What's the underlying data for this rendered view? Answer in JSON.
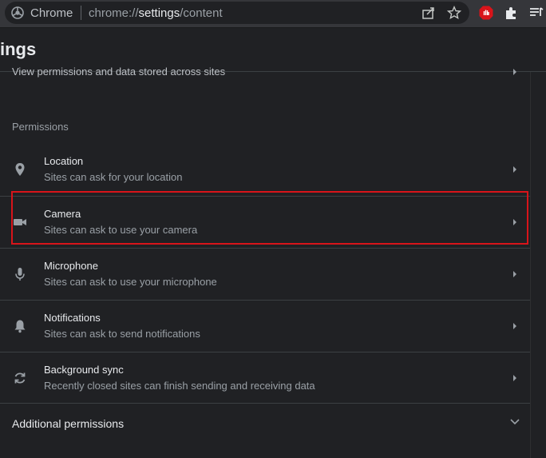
{
  "browser": {
    "chip_label": "Chrome",
    "url_scheme": "chrome://",
    "url_host": "settings",
    "url_path": "/content"
  },
  "header": {
    "title": "ings"
  },
  "prev_item": {
    "text": "View permissions and data stored across sites"
  },
  "permissions": {
    "heading": "Permissions",
    "items": [
      {
        "title": "Location",
        "subtitle": "Sites can ask for your location",
        "icon": "location-pin-icon"
      },
      {
        "title": "Camera",
        "subtitle": "Sites can ask to use your camera",
        "icon": "camera-icon"
      },
      {
        "title": "Microphone",
        "subtitle": "Sites can ask to use your microphone",
        "icon": "microphone-icon"
      },
      {
        "title": "Notifications",
        "subtitle": "Sites can ask to send notifications",
        "icon": "bell-icon"
      },
      {
        "title": "Background sync",
        "subtitle": "Recently closed sites can finish sending and receiving data",
        "icon": "sync-icon"
      }
    ]
  },
  "additional": {
    "label": "Additional permissions"
  },
  "colors": {
    "background": "#202124",
    "highlight": "#d8141a",
    "text": "#e8eaed",
    "subtext": "#9aa0a6"
  }
}
